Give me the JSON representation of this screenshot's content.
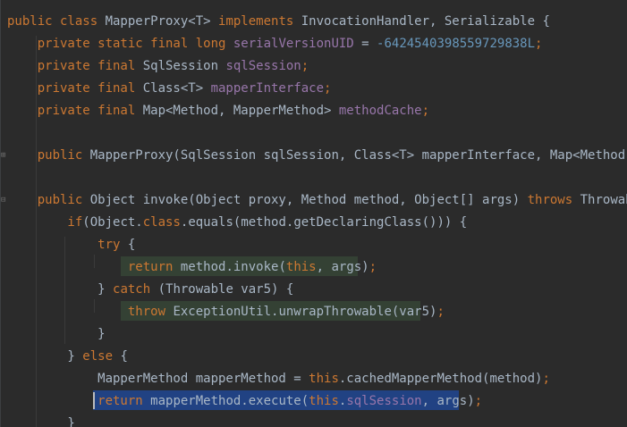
{
  "code": {
    "lines": [
      [
        {
          "t": "public class ",
          "c": "kw"
        },
        {
          "t": "MapperProxy<T> ",
          "c": "id"
        },
        {
          "t": "implements ",
          "c": "kw"
        },
        {
          "t": "InvocationHandler, Serializable {",
          "c": "id"
        }
      ],
      [
        {
          "t": "    private static final long ",
          "c": "kw"
        },
        {
          "t": "serialVersionUID",
          "c": "fld"
        },
        {
          "t": " = ",
          "c": "id"
        },
        {
          "t": "-6424540398559729838L",
          "c": "num"
        },
        {
          "t": ";",
          "c": "kw"
        }
      ],
      [
        {
          "t": "    private final ",
          "c": "kw"
        },
        {
          "t": "SqlSession ",
          "c": "id"
        },
        {
          "t": "sqlSession",
          "c": "fld"
        },
        {
          "t": ";",
          "c": "kw"
        }
      ],
      [
        {
          "t": "    private final ",
          "c": "kw"
        },
        {
          "t": "Class<T> ",
          "c": "id"
        },
        {
          "t": "mapperInterface",
          "c": "fld"
        },
        {
          "t": ";",
          "c": "kw"
        }
      ],
      [
        {
          "t": "    private final ",
          "c": "kw"
        },
        {
          "t": "Map<Method, MapperMethod> ",
          "c": "id"
        },
        {
          "t": "methodCache",
          "c": "fld"
        },
        {
          "t": ";",
          "c": "kw"
        }
      ],
      [],
      [
        {
          "t": "    public ",
          "c": "kw"
        },
        {
          "t": "MapperProxy(SqlSession sqlSession, Class<T> mapperInterface, Map<Method, MapperMethod> methodCache) {",
          "c": "id"
        }
      ],
      [],
      [
        {
          "t": "    public ",
          "c": "kw"
        },
        {
          "t": "Object invoke(Object proxy, Method method, Object[] args) ",
          "c": "id"
        },
        {
          "t": "throws ",
          "c": "kw"
        },
        {
          "t": "Throwable {",
          "c": "id"
        }
      ],
      [
        {
          "t": "        if",
          "c": "kw"
        },
        {
          "t": "(Object.",
          "c": "id"
        },
        {
          "t": "class",
          "c": "kw"
        },
        {
          "t": ".equals(method.getDeclaringClass())) {",
          "c": "id"
        }
      ],
      [
        {
          "t": "            try ",
          "c": "kw"
        },
        {
          "t": "{",
          "c": "id"
        }
      ],
      [
        {
          "t": "                return ",
          "c": "kw"
        },
        {
          "t": "method.invoke(",
          "c": "id"
        },
        {
          "t": "this",
          "c": "kw"
        },
        {
          "t": ", args)",
          "c": "id"
        },
        {
          "t": ";",
          "c": "kw"
        }
      ],
      [
        {
          "t": "            } ",
          "c": "id"
        },
        {
          "t": "catch ",
          "c": "kw"
        },
        {
          "t": "(Throwable var5) {",
          "c": "id"
        }
      ],
      [
        {
          "t": "                throw ",
          "c": "kw"
        },
        {
          "t": "ExceptionUtil.unwrapThrowable(var5)",
          "c": "id"
        },
        {
          "t": ";",
          "c": "kw"
        }
      ],
      [
        {
          "t": "            }",
          "c": "id"
        }
      ],
      [
        {
          "t": "        } ",
          "c": "id"
        },
        {
          "t": "else ",
          "c": "kw"
        },
        {
          "t": "{",
          "c": "id"
        }
      ],
      [
        {
          "t": "            MapperMethod mapperMethod = ",
          "c": "id"
        },
        {
          "t": "this",
          "c": "kw"
        },
        {
          "t": ".cachedMapperMethod(method)",
          "c": "id"
        },
        {
          "t": ";",
          "c": "kw"
        }
      ],
      [
        {
          "t": "            return ",
          "c": "kw"
        },
        {
          "t": "mapperMethod.execute(",
          "c": "id"
        },
        {
          "t": "this",
          "c": "kw"
        },
        {
          "t": ".",
          "c": "id"
        },
        {
          "t": "sqlSession",
          "c": "fld"
        },
        {
          "t": ", args)",
          "c": "id"
        },
        {
          "t": ";",
          "c": "kw"
        }
      ],
      [
        {
          "t": "        }",
          "c": "id"
        }
      ]
    ]
  },
  "colors": {
    "background": "#2b2b2b",
    "keyword": "#cc7832",
    "identifier": "#a9b7c6",
    "field": "#9876aa",
    "number": "#6897bb",
    "highlight_green": "#344134",
    "selection_blue": "#214283"
  },
  "icons": {
    "fold_marker": "fold-plus-icon"
  }
}
